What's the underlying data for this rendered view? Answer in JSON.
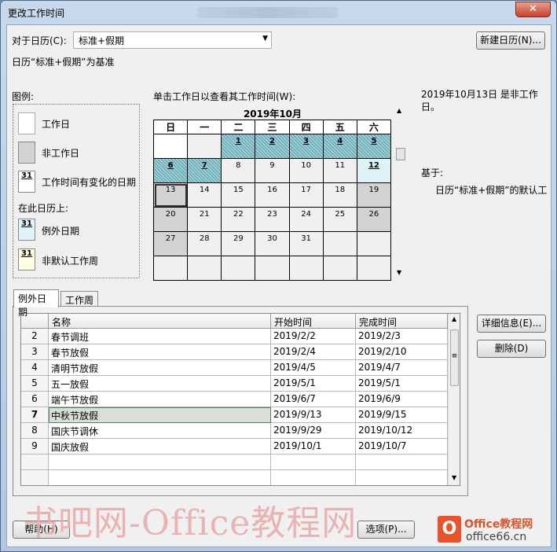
{
  "window": {
    "title": "更改工作时间"
  },
  "calendar_select": {
    "label": "对于日历(C):",
    "value": "标准+假期"
  },
  "new_calendar_button": "新建日历(N)...",
  "base_info": "日历“标准+假期”为基准",
  "legend": {
    "title": "图例:",
    "items": [
      "工作日",
      "非工作日",
      "工作时间有变化的日期"
    ],
    "subtitle": "在此日历上:",
    "calendar_items": [
      "例外日期",
      "非默认工作周"
    ],
    "swatch_number": "31"
  },
  "calendar": {
    "instruction": "单击工作日以查看其工作时间(W):",
    "month": "2019年10月",
    "weekdays": [
      "日",
      "一",
      "二",
      "三",
      "四",
      "五",
      "六"
    ],
    "weeks": [
      [
        "",
        "",
        "1",
        "2",
        "3",
        "4",
        "5"
      ],
      [
        "6",
        "7",
        "8",
        "9",
        "10",
        "11",
        "12"
      ],
      [
        "13",
        "14",
        "15",
        "16",
        "17",
        "18",
        "19"
      ],
      [
        "20",
        "21",
        "22",
        "23",
        "24",
        "25",
        "26"
      ],
      [
        "27",
        "28",
        "29",
        "30",
        "31",
        "",
        ""
      ],
      [
        "",
        "",
        "",
        "",
        "",
        "",
        ""
      ]
    ]
  },
  "day_info": {
    "text": "2019年10月13日 是非工作日。",
    "based_on_label": "基于:",
    "based_on_value": "日历“标准+假期”的默认工"
  },
  "tabs": [
    "例外日期",
    "工作周"
  ],
  "exceptions": {
    "columns": [
      "名称",
      "开始时间",
      "完成时间"
    ],
    "rows": [
      {
        "num": "2",
        "name": "春节调班",
        "start": "2019/2/2",
        "end": "2019/2/3"
      },
      {
        "num": "3",
        "name": "春节放假",
        "start": "2019/2/4",
        "end": "2019/2/10"
      },
      {
        "num": "4",
        "name": "清明节放假",
        "start": "2019/4/5",
        "end": "2019/4/7"
      },
      {
        "num": "5",
        "name": "五一放假",
        "start": "2019/5/1",
        "end": "2019/5/1"
      },
      {
        "num": "6",
        "name": "端午节放假",
        "start": "2019/6/7",
        "end": "2019/6/9"
      },
      {
        "num": "7",
        "name": "中秋节放假",
        "start": "2019/9/13",
        "end": "2019/9/15"
      },
      {
        "num": "8",
        "name": "国庆节调休",
        "start": "2019/9/29",
        "end": "2019/10/12"
      },
      {
        "num": "9",
        "name": "国庆放假",
        "start": "2019/10/1",
        "end": "2019/10/7"
      }
    ]
  },
  "buttons": {
    "details": "详细信息(E)...",
    "delete": "删除(D)",
    "help": "帮助(H)",
    "options": "选项(P)..."
  },
  "watermark": "书吧网-Office教程网",
  "logo": {
    "line1": "Office教程网",
    "line2": "office66.cn"
  }
}
